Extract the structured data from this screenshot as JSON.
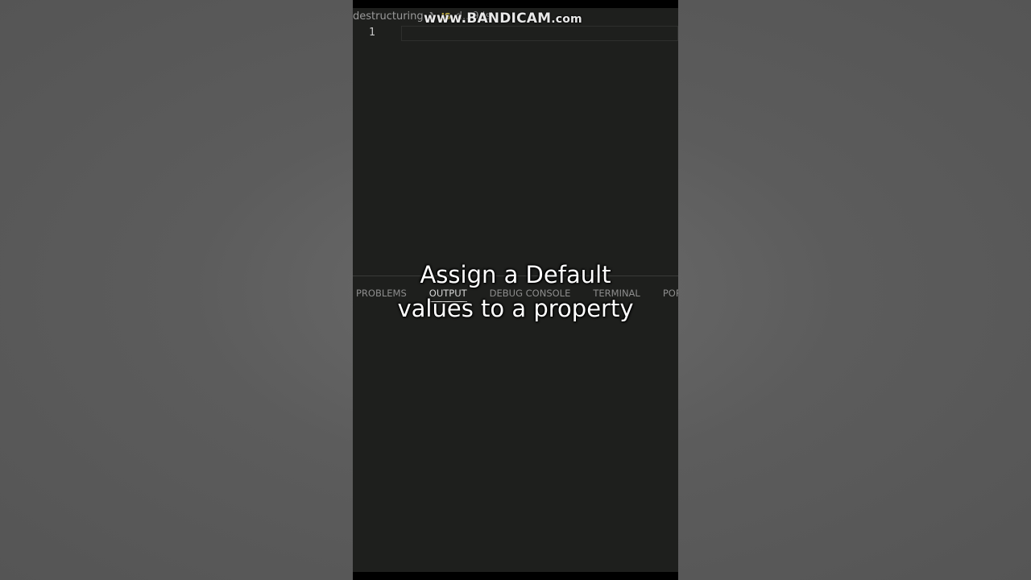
{
  "breadcrumb": {
    "folder": "destructuring",
    "separator": "❯",
    "file_icon": "JS",
    "file_name": "d...9.js"
  },
  "watermark": {
    "text_main": "www.BANDICAM",
    "text_suffix": ".com"
  },
  "editor": {
    "line_numbers": [
      "1"
    ]
  },
  "panel": {
    "tabs": [
      {
        "label": "PROBLEMS",
        "active": false
      },
      {
        "label": "OUTPUT",
        "active": true
      },
      {
        "label": "DEBUG CONSOLE",
        "active": false
      },
      {
        "label": "TERMINAL",
        "active": false
      },
      {
        "label": "POR",
        "active": false
      }
    ]
  },
  "caption": {
    "line1": "Assign a Default",
    "line2": "values to a property"
  },
  "colors": {
    "editor_bg": "#1e1f1d",
    "outer_bg": "#5a5a5a",
    "js_icon": "#d4c04a"
  }
}
